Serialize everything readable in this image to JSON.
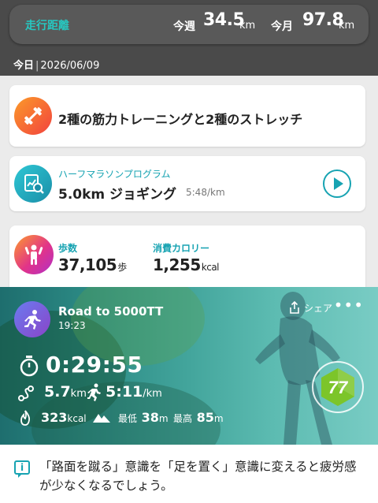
{
  "header": {
    "distance_title": "走行距離",
    "week_label": "今週",
    "week_value": "34.5",
    "week_unit": "km",
    "month_label": "今月",
    "month_value": "97.8",
    "month_unit": "km",
    "today_label": "今日",
    "date": "2026/06/09"
  },
  "training": {
    "icon": "dumbbell-icon",
    "title": "2種の筋力トレーニングと2種のストレッチ"
  },
  "program": {
    "icon": "program-chart-icon",
    "name": "ハーフマラソンプログラム",
    "workout": "5.0km ジョギング",
    "pace": "5:48/km"
  },
  "activity": {
    "icon": "body-icon",
    "steps_label": "歩数",
    "steps_value": "37,105",
    "steps_unit": "歩",
    "calories_label": "消費カロリー",
    "calories_value": "1,255",
    "calories_unit": "kcal"
  },
  "run": {
    "icon": "runner-icon",
    "title": "Road to 5000TT",
    "time": "19:23",
    "share_label": "シェア",
    "more_label": "•••",
    "duration": "0:29:55",
    "distance_value": "5.7",
    "distance_unit": "km",
    "pace_value": "5:11",
    "pace_unit": "/km",
    "calories_value": "323",
    "calories_unit": "kcal",
    "low_label": "最低",
    "low_value": "38",
    "low_unit": "m",
    "high_label": "最高",
    "high_value": "85",
    "high_unit": "m",
    "score": "77",
    "score_color": "#7cc52a"
  },
  "tip": {
    "icon": "info-icon",
    "icon_glyph": "i",
    "text": "「路面を蹴る」意識を「足を置く」意識に変えると疲労感が少なくなるでしょう。"
  },
  "colors": {
    "accent": "#17a3b2",
    "header_bg": "#4a4a4a",
    "distance_title": "#27c7c0"
  }
}
